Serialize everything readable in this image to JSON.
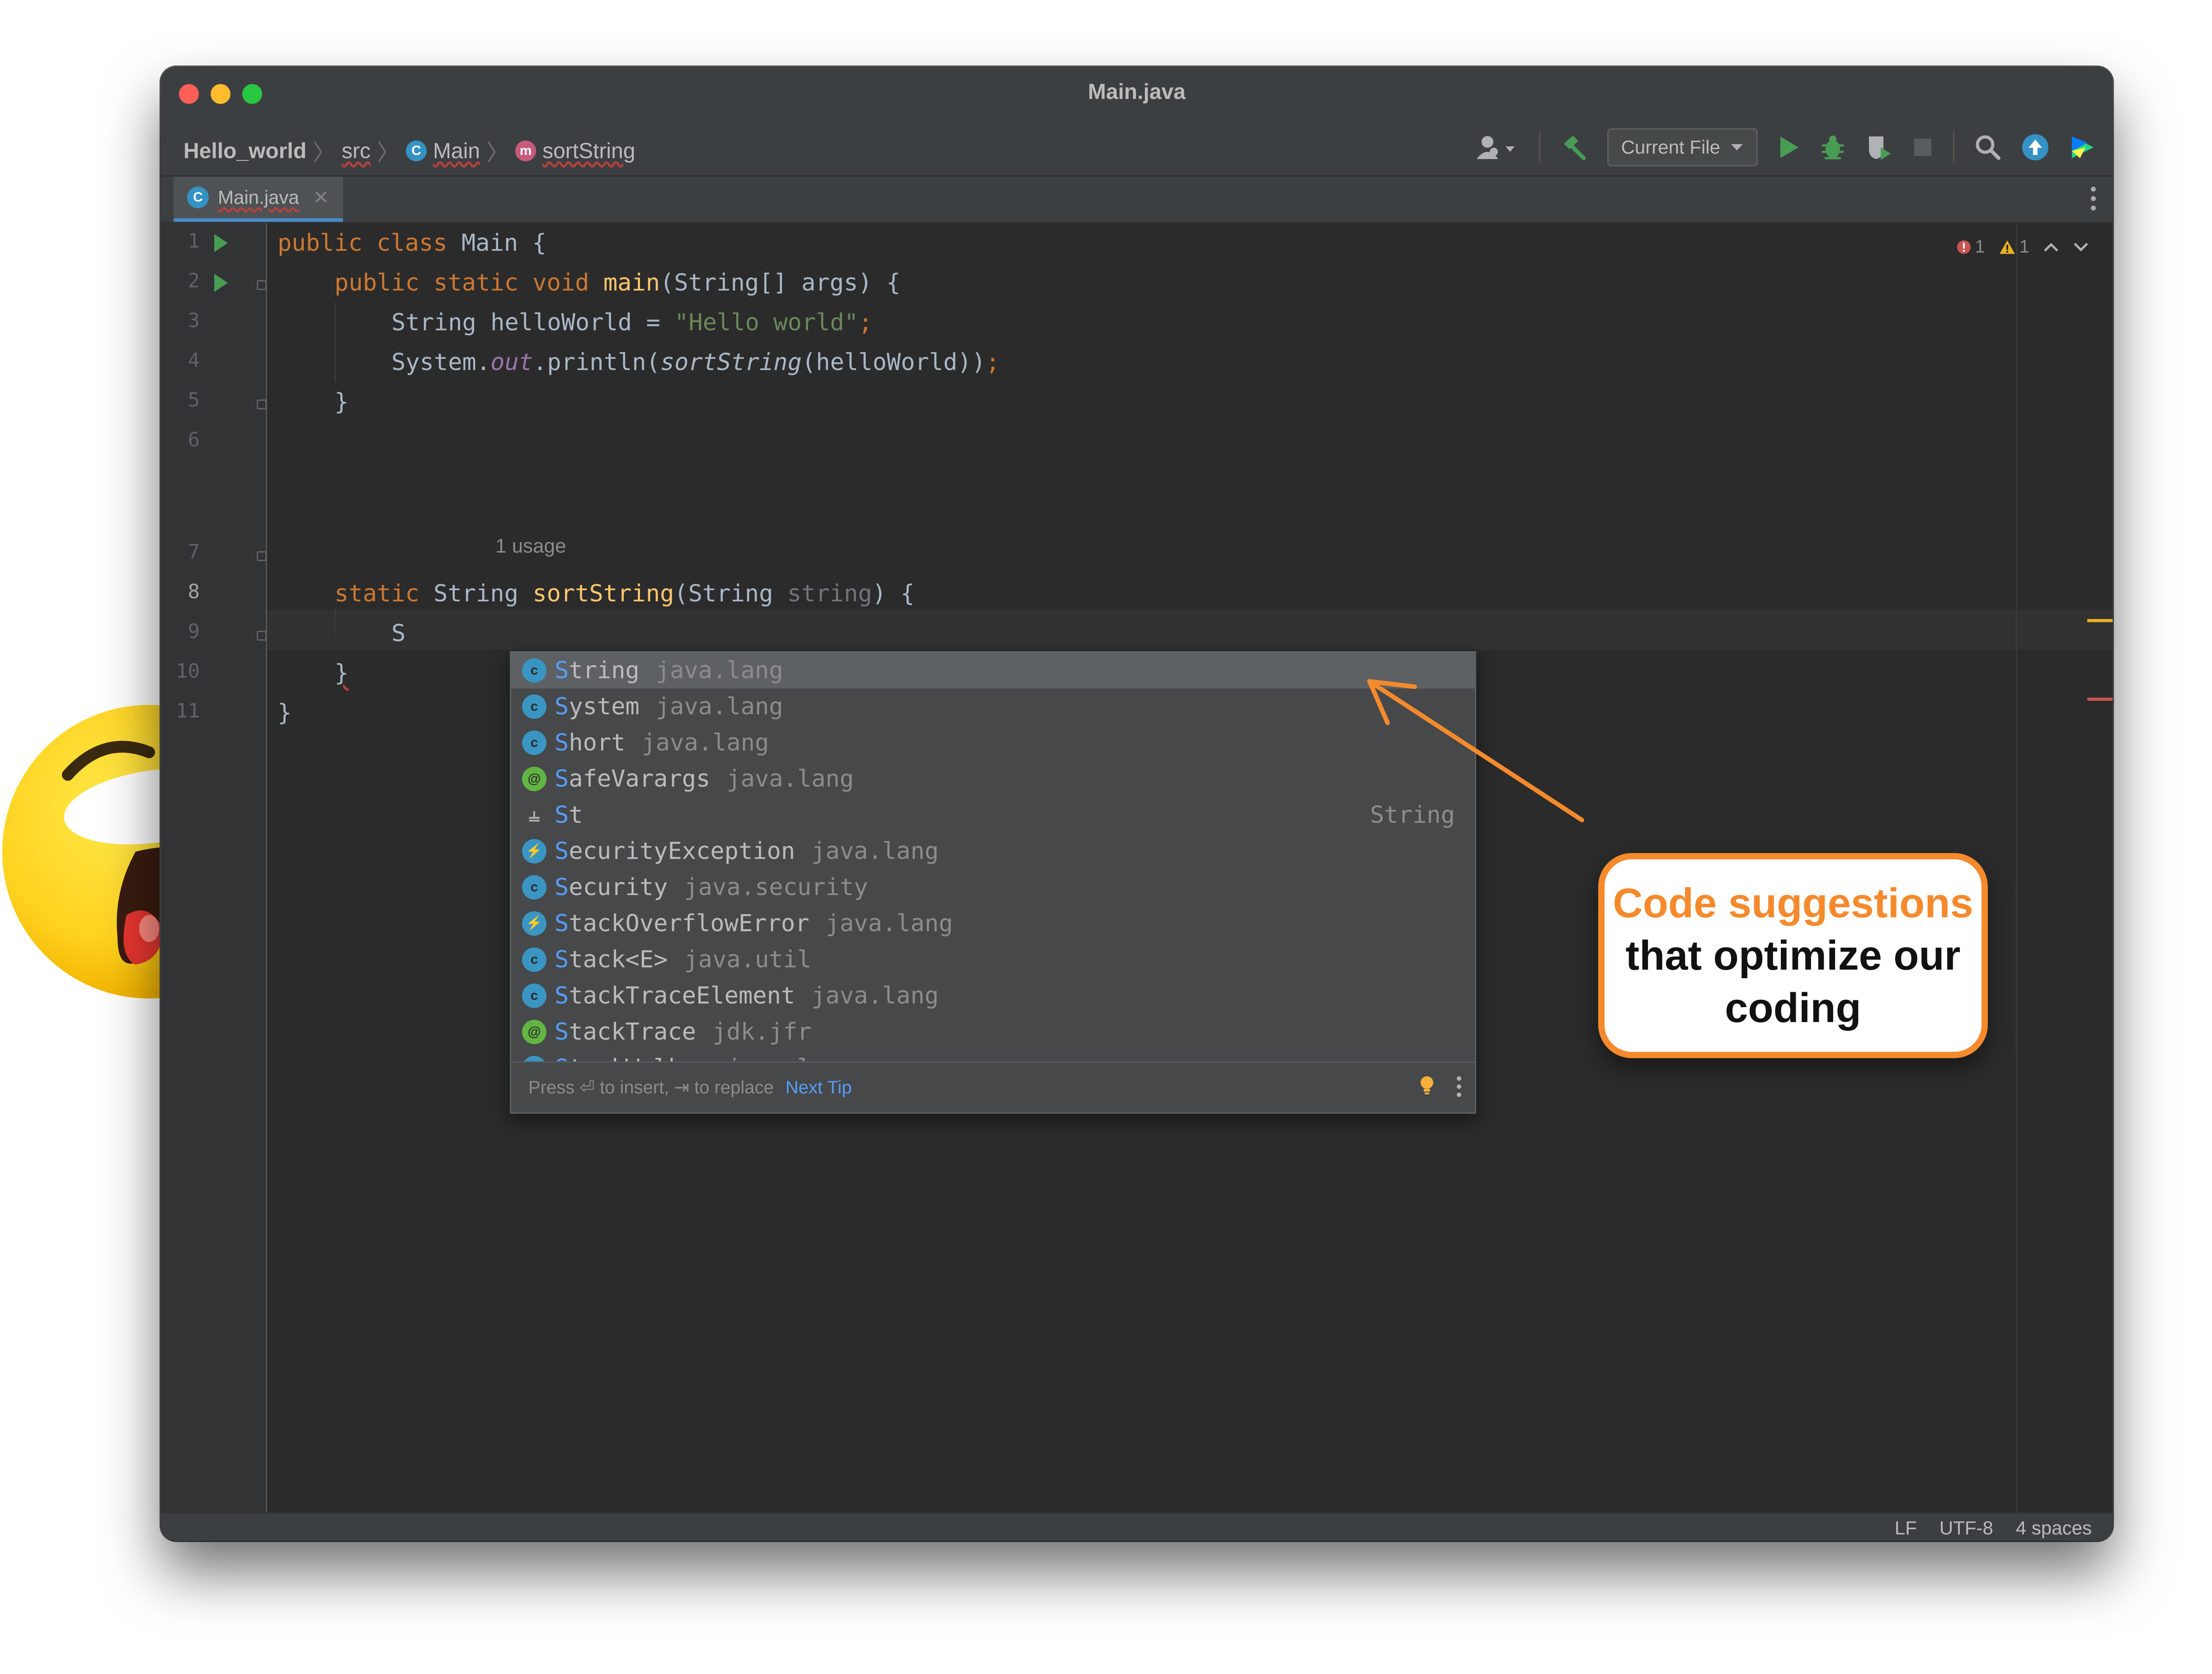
{
  "window": {
    "title": "Main.java"
  },
  "breadcrumbs": [
    {
      "label": "Hello_world",
      "icon": "none"
    },
    {
      "label": "src",
      "icon": "none"
    },
    {
      "label": "Main",
      "icon": "class-icon"
    },
    {
      "label": "sortString",
      "icon": "method-icon"
    }
  ],
  "toolbar": {
    "run_config": "Current File"
  },
  "tab": {
    "label": "Main.java"
  },
  "inspection": {
    "errors": "1",
    "warnings": "1"
  },
  "code": {
    "line_numbers": [
      "1",
      "2",
      "3",
      "4",
      "5",
      "6",
      "7",
      "8",
      "9",
      "10",
      "11"
    ],
    "usage_hint": "1 usage",
    "lines": {
      "l1_kw": "public class ",
      "l1_rest": "Main {",
      "l2_kw": "public static void ",
      "l2_fn": "main",
      "l2_rest": "(String[] args) {",
      "l3_a": "String helloWorld = ",
      "l3_str": "\"Hello world\"",
      "l3_semi": ";",
      "l4_a": "System.",
      "l4_field": "out",
      "l4_b": ".println(",
      "l4_it": "sortString",
      "l4_c": "(helloWorld))",
      "l4_semi": ";",
      "l5": "}",
      "l7_kw": "static ",
      "l7_a": "String ",
      "l7_fn": "sortString",
      "l7_b": "(String ",
      "l7_param": "string",
      "l7_c": ") {",
      "l8": "S",
      "l9": "}",
      "l10": "}"
    }
  },
  "completion": {
    "items": [
      {
        "match": "S",
        "rest": "tring",
        "pkg": "java.lang",
        "icon": "class-icon",
        "selected": true
      },
      {
        "match": "S",
        "rest": "ystem",
        "pkg": "java.lang",
        "icon": "class-icon"
      },
      {
        "match": "S",
        "rest": "hort",
        "pkg": "java.lang",
        "icon": "class-icon"
      },
      {
        "match": "S",
        "rest": "afeVarargs",
        "pkg": "java.lang",
        "icon": "annotation-icon"
      },
      {
        "match": "S",
        "rest": "t",
        "pkg": "",
        "icon": "template-icon",
        "type": "String"
      },
      {
        "match": "S",
        "rest": "ecurityException",
        "pkg": "java.lang",
        "icon": "exception-icon"
      },
      {
        "match": "S",
        "rest": "ecurity",
        "pkg": "java.security",
        "icon": "class-icon"
      },
      {
        "match": "S",
        "rest": "tackOverflowError",
        "pkg": "java.lang",
        "icon": "exception-icon"
      },
      {
        "match": "S",
        "rest": "tack<E>",
        "pkg": "java.util",
        "icon": "class-icon"
      },
      {
        "match": "S",
        "rest": "tackTraceElement",
        "pkg": "java.lang",
        "icon": "class-icon"
      },
      {
        "match": "S",
        "rest": "tackTrace",
        "pkg": "jdk.jfr",
        "icon": "annotation-icon"
      },
      {
        "match": "S",
        "rest": "tackWalker",
        "pkg": "java.lang",
        "icon": "class-icon"
      }
    ],
    "footer": "Press ⏎ to insert, ⇥ to replace",
    "next_tip": "Next Tip"
  },
  "status": {
    "line_sep": "LF",
    "encoding": "UTF-8",
    "indent": "4 spaces"
  },
  "annotation": {
    "highlight": "Code suggestions",
    "line2": "that optimize our",
    "line3": "coding"
  },
  "colors": {
    "accent": "#f58a2d",
    "keyword": "#cc7832",
    "function": "#ffc66d",
    "string": "#6a8759",
    "link": "#589df6"
  }
}
